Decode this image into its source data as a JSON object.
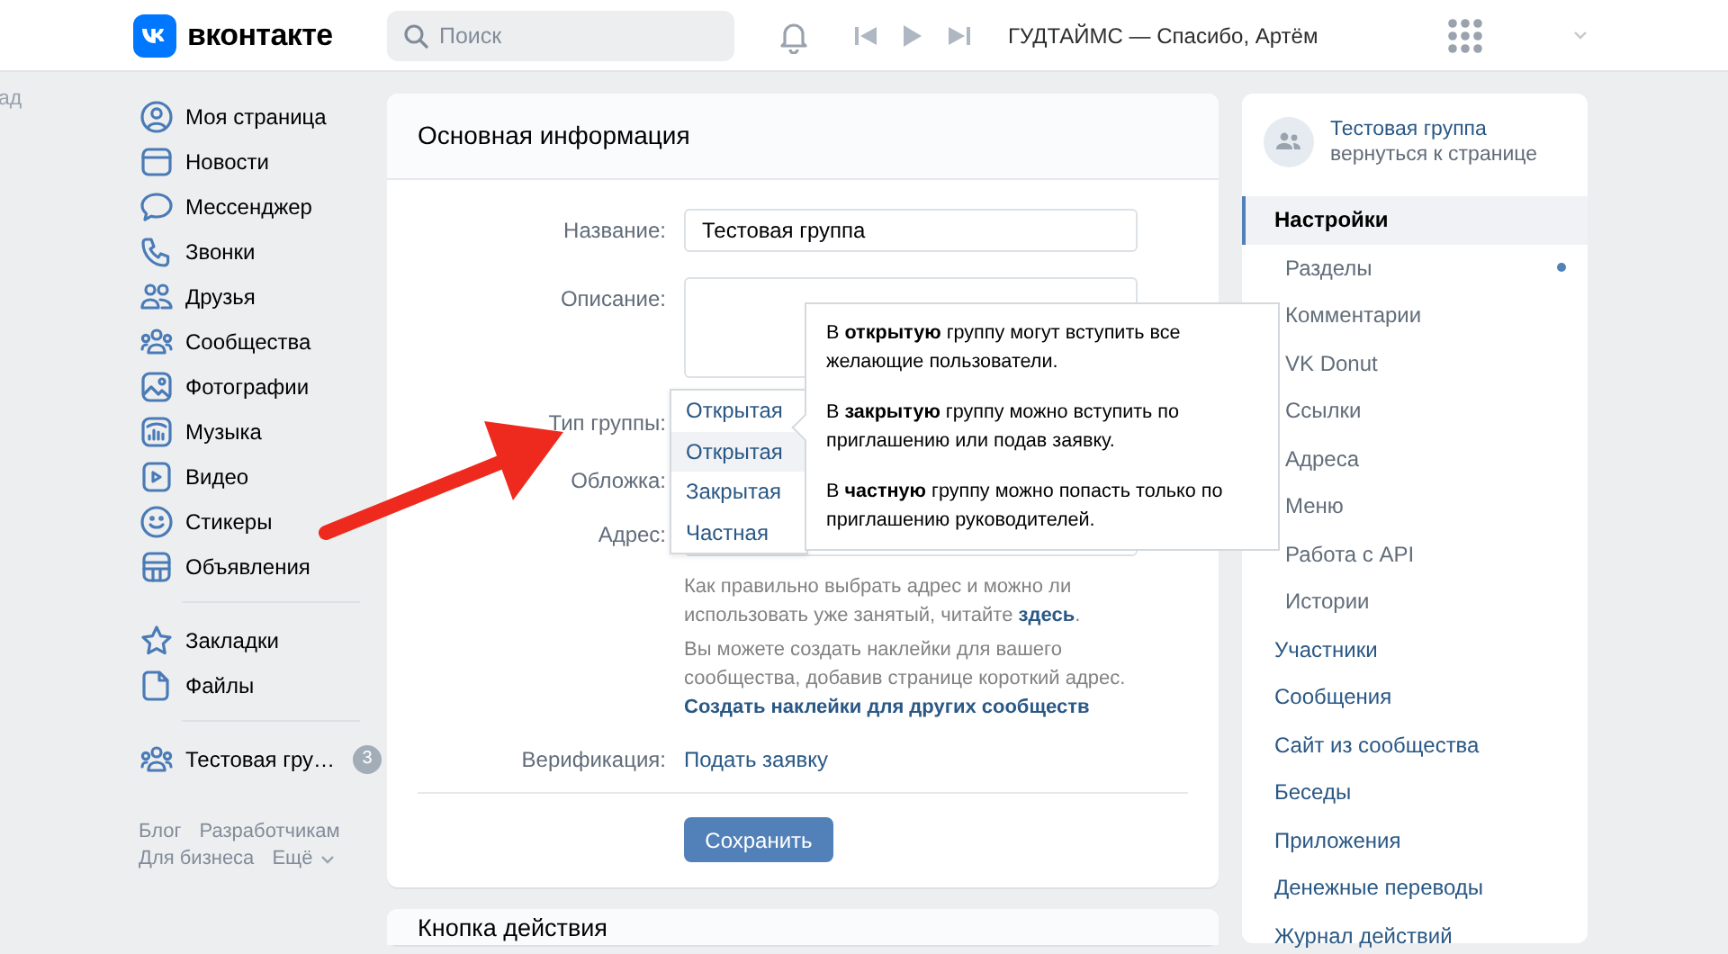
{
  "edge_text": "ад",
  "header": {
    "logo": "вконтакте",
    "search": {
      "placeholder": "Поиск"
    },
    "track": "ГУДТАЙМС — Спасибо, Артём"
  },
  "nav": {
    "groups": [
      [
        {
          "label": "Моя страница"
        },
        {
          "label": "Новости"
        },
        {
          "label": "Мессенджер"
        },
        {
          "label": "Звонки"
        },
        {
          "label": "Друзья"
        },
        {
          "label": "Сообщества"
        },
        {
          "label": "Фотографии"
        },
        {
          "label": "Музыка"
        },
        {
          "label": "Видео"
        },
        {
          "label": "Стикеры"
        },
        {
          "label": "Объявления"
        }
      ],
      [
        {
          "label": "Закладки"
        },
        {
          "label": "Файлы"
        }
      ],
      [
        {
          "label": "Тестовая гру…",
          "badge": "3"
        }
      ]
    ],
    "footer": [
      "Блог",
      "Разработчикам",
      "Для бизнеса",
      "Ещё"
    ]
  },
  "main": {
    "title": "Основная информация",
    "fields": [
      {
        "kind": "input",
        "label": "Название:",
        "value": "Тестовая группа"
      },
      {
        "kind": "textarea",
        "label": "Описание:"
      },
      {
        "kind": "select",
        "label": "Тип группы:",
        "value": "Открытая",
        "open": true,
        "options": [
          {
            "label": "Открытая",
            "selected": true
          },
          {
            "label": "Закрытая",
            "selected": false
          },
          {
            "label": "Частная",
            "selected": false
          }
        ]
      },
      {
        "kind": "blank",
        "label": "Обложка:"
      },
      {
        "kind": "input",
        "label": "Адрес:"
      },
      {
        "kind": "note",
        "text": "Как правильно выбрать адрес и можно ли использовать уже занятый, читайте ",
        "link": "здесь",
        "after": "."
      },
      {
        "kind": "note",
        "text": "Вы можете создать наклейки для вашего сообщества, добавив странице короткий адрес.",
        "link": "Создать наклейки для других сообществ"
      },
      {
        "kind": "link",
        "label": "Верификация:",
        "value": "Подать заявку"
      }
    ],
    "save": "Сохранить",
    "tooltip": [
      "В **открытую** группу могут вступить все желающие пользователи.",
      "В **закрытую** группу можно вступить по приглашению или подав заявку.",
      "В **частную** группу можно попасть только по приглашению руководителей."
    ]
  },
  "next_card": {
    "title": "Кнопка действия"
  },
  "right": {
    "group": {
      "name": "Тестовая группа",
      "subtitle": "вернуться к странице"
    },
    "menu": [
      {
        "label": "Настройки",
        "selected": true,
        "children": [
          {
            "label": "Разделы",
            "selected": false,
            "unread": true
          },
          {
            "label": "Комментарии",
            "selected": false,
            "unread": false
          },
          {
            "label": "VK Donut",
            "selected": false,
            "unread": false
          },
          {
            "label": "Ссылки",
            "selected": false,
            "unread": false
          },
          {
            "label": "Адреса",
            "selected": false,
            "unread": false
          },
          {
            "label": "Меню",
            "selected": false,
            "unread": false
          },
          {
            "label": "Работа с API",
            "selected": false,
            "unread": false
          },
          {
            "label": "Истории",
            "selected": false,
            "unread": false
          }
        ]
      },
      {
        "label": "Участники",
        "selected": false
      },
      {
        "label": "Сообщения",
        "selected": false
      },
      {
        "label": "Сайт из сообщества",
        "selected": false
      },
      {
        "label": "Беседы",
        "selected": false
      },
      {
        "label": "Приложения",
        "selected": false
      },
      {
        "label": "Денежные переводы",
        "selected": false
      },
      {
        "label": "Журнал действий",
        "selected": false
      }
    ]
  }
}
